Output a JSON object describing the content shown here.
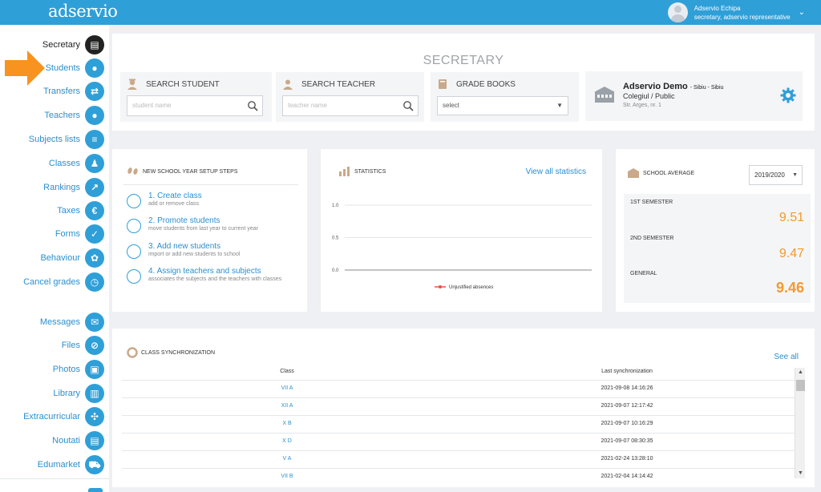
{
  "app": {
    "logo": "adservio"
  },
  "user": {
    "name": "Adservio Echipa",
    "role": "secretary, adservio representative"
  },
  "sidebar": {
    "items": [
      {
        "label": "Secretary",
        "icon": "secretary-icon",
        "glyph": "▤",
        "active": true
      },
      {
        "label": "Students",
        "icon": "student-icon",
        "glyph": "●"
      },
      {
        "label": "Transfers",
        "icon": "transfer-icon",
        "glyph": "⇄"
      },
      {
        "label": "Teachers",
        "icon": "teacher-icon",
        "glyph": "●"
      },
      {
        "label": "Subjects lists",
        "icon": "list-icon",
        "glyph": "≡"
      },
      {
        "label": "Classes",
        "icon": "classes-icon",
        "glyph": "♟"
      },
      {
        "label": "Rankings",
        "icon": "rankings-icon",
        "glyph": "↗"
      },
      {
        "label": "Taxes",
        "icon": "euro-icon",
        "glyph": "€"
      },
      {
        "label": "Forms",
        "icon": "forms-icon",
        "glyph": "✓"
      },
      {
        "label": "Behaviour",
        "icon": "behaviour-icon",
        "glyph": "✿"
      },
      {
        "label": "Cancel grades",
        "icon": "cancel-grades-icon",
        "glyph": "◷"
      },
      {
        "label": "Messages",
        "icon": "envelope-icon",
        "glyph": "✉"
      },
      {
        "label": "Files",
        "icon": "paperclip-icon",
        "glyph": "⊘"
      },
      {
        "label": "Photos",
        "icon": "photos-icon",
        "glyph": "▣"
      },
      {
        "label": "Library",
        "icon": "library-icon",
        "glyph": "▥"
      },
      {
        "label": "Extracurricular",
        "icon": "extracurricular-icon",
        "glyph": "✣"
      },
      {
        "label": "Noutati",
        "icon": "news-icon",
        "glyph": "▤"
      },
      {
        "label": "Edumarket",
        "icon": "cart-icon",
        "glyph": "⛟"
      }
    ]
  },
  "secretary": {
    "title": "SECRETARY",
    "search_student": {
      "label": "SEARCH STUDENT",
      "placeholder": "student name"
    },
    "search_teacher": {
      "label": "SEARCH TEACHER",
      "placeholder": "teacher name"
    },
    "grade_books": {
      "label": "GRADE BOOKS",
      "value": "select"
    },
    "school": {
      "name": "Adservio Demo",
      "city": "- Sibiu - Sibiu",
      "type": "Colegiul / Public",
      "address": "Str. Arges, nr. 1"
    }
  },
  "setup": {
    "title": "NEW SCHOOL YEAR SETUP STEPS",
    "steps": [
      {
        "title": "1. Create class",
        "sub": "add or remove class"
      },
      {
        "title": "2. Promote students",
        "sub": "move students from last year to current year"
      },
      {
        "title": "3. Add new students",
        "sub": "import or add new students to school"
      },
      {
        "title": "4. Assign teachers and subjects",
        "sub": "associates the subjects and the teachers with classes"
      }
    ]
  },
  "statistics": {
    "title": "STATISTICS",
    "link": "View all statistics"
  },
  "chart_data": {
    "type": "line",
    "title": "",
    "ylim": [
      0.0,
      1.0
    ],
    "yticks": [
      "1.0",
      "0.5",
      "0.0"
    ],
    "series": [
      {
        "name": "Unjustified absences",
        "color": "#e8533a",
        "values": []
      }
    ],
    "legend": "bottom"
  },
  "average": {
    "title": "SCHOOL AVERAGE",
    "year": "2019/2020",
    "rows": [
      {
        "label": "1ST SEMESTER",
        "value": "9.51"
      },
      {
        "label": "2ND SEMESTER",
        "value": "9.47"
      },
      {
        "label": "GENERAL",
        "value": "9.46"
      }
    ]
  },
  "sync": {
    "title": "CLASS SYNCHRONIZATION",
    "see_all": "See all",
    "headers": {
      "class": "Class",
      "last": "Last synchronization"
    },
    "rows": [
      {
        "class": "VII A",
        "time": "2021-09-08 14:16:26"
      },
      {
        "class": "XII A",
        "time": "2021-09-07 12:17:42"
      },
      {
        "class": "X B",
        "time": "2021-09-07 10:16:29"
      },
      {
        "class": "X D",
        "time": "2021-09-07 08:30:35"
      },
      {
        "class": "V A",
        "time": "2021-02-24 13:28:10"
      },
      {
        "class": "VII B",
        "time": "2021-02-04 14:14:42"
      }
    ]
  },
  "colors": {
    "accent": "#2f9fd8",
    "orange": "#f29a2e",
    "arrow": "#f7931e"
  }
}
